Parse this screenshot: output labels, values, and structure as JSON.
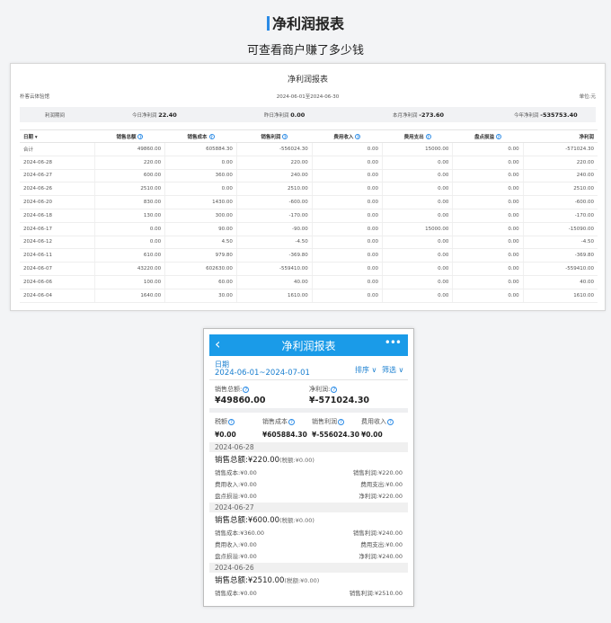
{
  "heading": {
    "title": "净利润报表",
    "subtitle": "可查看商户赚了多少钱"
  },
  "desktop": {
    "title": "净利润报表",
    "store": "朴客云体验馆",
    "range": "2024-06-01至2024-06-30",
    "unit": "单位:元",
    "summary": {
      "label": "利润期间",
      "today_label": "今日净利润",
      "today_value": "22.40",
      "yesterday_label": "昨日净利润",
      "yesterday_value": "0.00",
      "month_label": "本月净利润",
      "month_value": "-273.60",
      "year_label": "今年净利润",
      "year_value": "-535753.40"
    },
    "columns": [
      "日期 ▾",
      "销售总额",
      "销售成本",
      "销售利润",
      "费用收入",
      "费用支出",
      "盘点损溢",
      "净利润"
    ],
    "rows": [
      [
        "合计",
        "49860.00",
        "605884.30",
        "-556024.30",
        "0.00",
        "15000.00",
        "0.00",
        "-571024.30"
      ],
      [
        "2024-06-28",
        "220.00",
        "0.00",
        "220.00",
        "0.00",
        "0.00",
        "0.00",
        "220.00"
      ],
      [
        "2024-06-27",
        "600.00",
        "360.00",
        "240.00",
        "0.00",
        "0.00",
        "0.00",
        "240.00"
      ],
      [
        "2024-06-26",
        "2510.00",
        "0.00",
        "2510.00",
        "0.00",
        "0.00",
        "0.00",
        "2510.00"
      ],
      [
        "2024-06-20",
        "830.00",
        "1430.00",
        "-600.00",
        "0.00",
        "0.00",
        "0.00",
        "-600.00"
      ],
      [
        "2024-06-18",
        "130.00",
        "300.00",
        "-170.00",
        "0.00",
        "0.00",
        "0.00",
        "-170.00"
      ],
      [
        "2024-06-17",
        "0.00",
        "90.00",
        "-90.00",
        "0.00",
        "15000.00",
        "0.00",
        "-15090.00"
      ],
      [
        "2024-06-12",
        "0.00",
        "4.50",
        "-4.50",
        "0.00",
        "0.00",
        "0.00",
        "-4.50"
      ],
      [
        "2024-06-11",
        "610.00",
        "979.80",
        "-369.80",
        "0.00",
        "0.00",
        "0.00",
        "-369.80"
      ],
      [
        "2024-06-07",
        "43220.00",
        "602630.00",
        "-559410.00",
        "0.00",
        "0.00",
        "0.00",
        "-559410.00"
      ],
      [
        "2024-06-06",
        "100.00",
        "60.00",
        "40.00",
        "0.00",
        "0.00",
        "0.00",
        "40.00"
      ],
      [
        "2024-06-04",
        "1640.00",
        "30.00",
        "1610.00",
        "0.00",
        "0.00",
        "0.00",
        "1610.00"
      ]
    ]
  },
  "mobile": {
    "header_title": "净利润报表",
    "back_icon": "‹",
    "more_icon": "•••",
    "date_label": "日期",
    "date_range": "2024-06-01~2024-07-01",
    "sort_label": "排序",
    "filter_label": "筛选",
    "sales_total_label": "销售总额:",
    "sales_total_value": "¥49860.00",
    "net_profit_label": "净利润:",
    "net_profit_value": "¥-571024.30",
    "tax_label": "税额",
    "tax_value": "¥0.00",
    "cost_label": "销售成本",
    "cost_value": "¥605884.30",
    "profit_label": "销售利润",
    "profit_value": "¥-556024.30",
    "income_label": "费用收入",
    "income_value": "¥0.00",
    "days": [
      {
        "date": "2024-06-28",
        "total": "销售总额:¥220.00",
        "tax": "(税额:¥0.00)",
        "cost": "销售成本:¥0.00",
        "profit": "销售利润:¥220.00",
        "income": "费用收入:¥0.00",
        "expense": "费用支出:¥0.00",
        "loss": "盘点损溢:¥0.00",
        "net": "净利润:¥220.00"
      },
      {
        "date": "2024-06-27",
        "total": "销售总额:¥600.00",
        "tax": "(税额:¥0.00)",
        "cost": "销售成本:¥360.00",
        "profit": "销售利润:¥240.00",
        "income": "费用收入:¥0.00",
        "expense": "费用支出:¥0.00",
        "loss": "盘点损溢:¥0.00",
        "net": "净利润:¥240.00"
      },
      {
        "date": "2024-06-26",
        "total": "销售总额:¥2510.00",
        "tax": "(税额:¥0.00)",
        "cost": "销售成本:¥0.00",
        "profit": "销售利润:¥2510.00"
      }
    ]
  }
}
